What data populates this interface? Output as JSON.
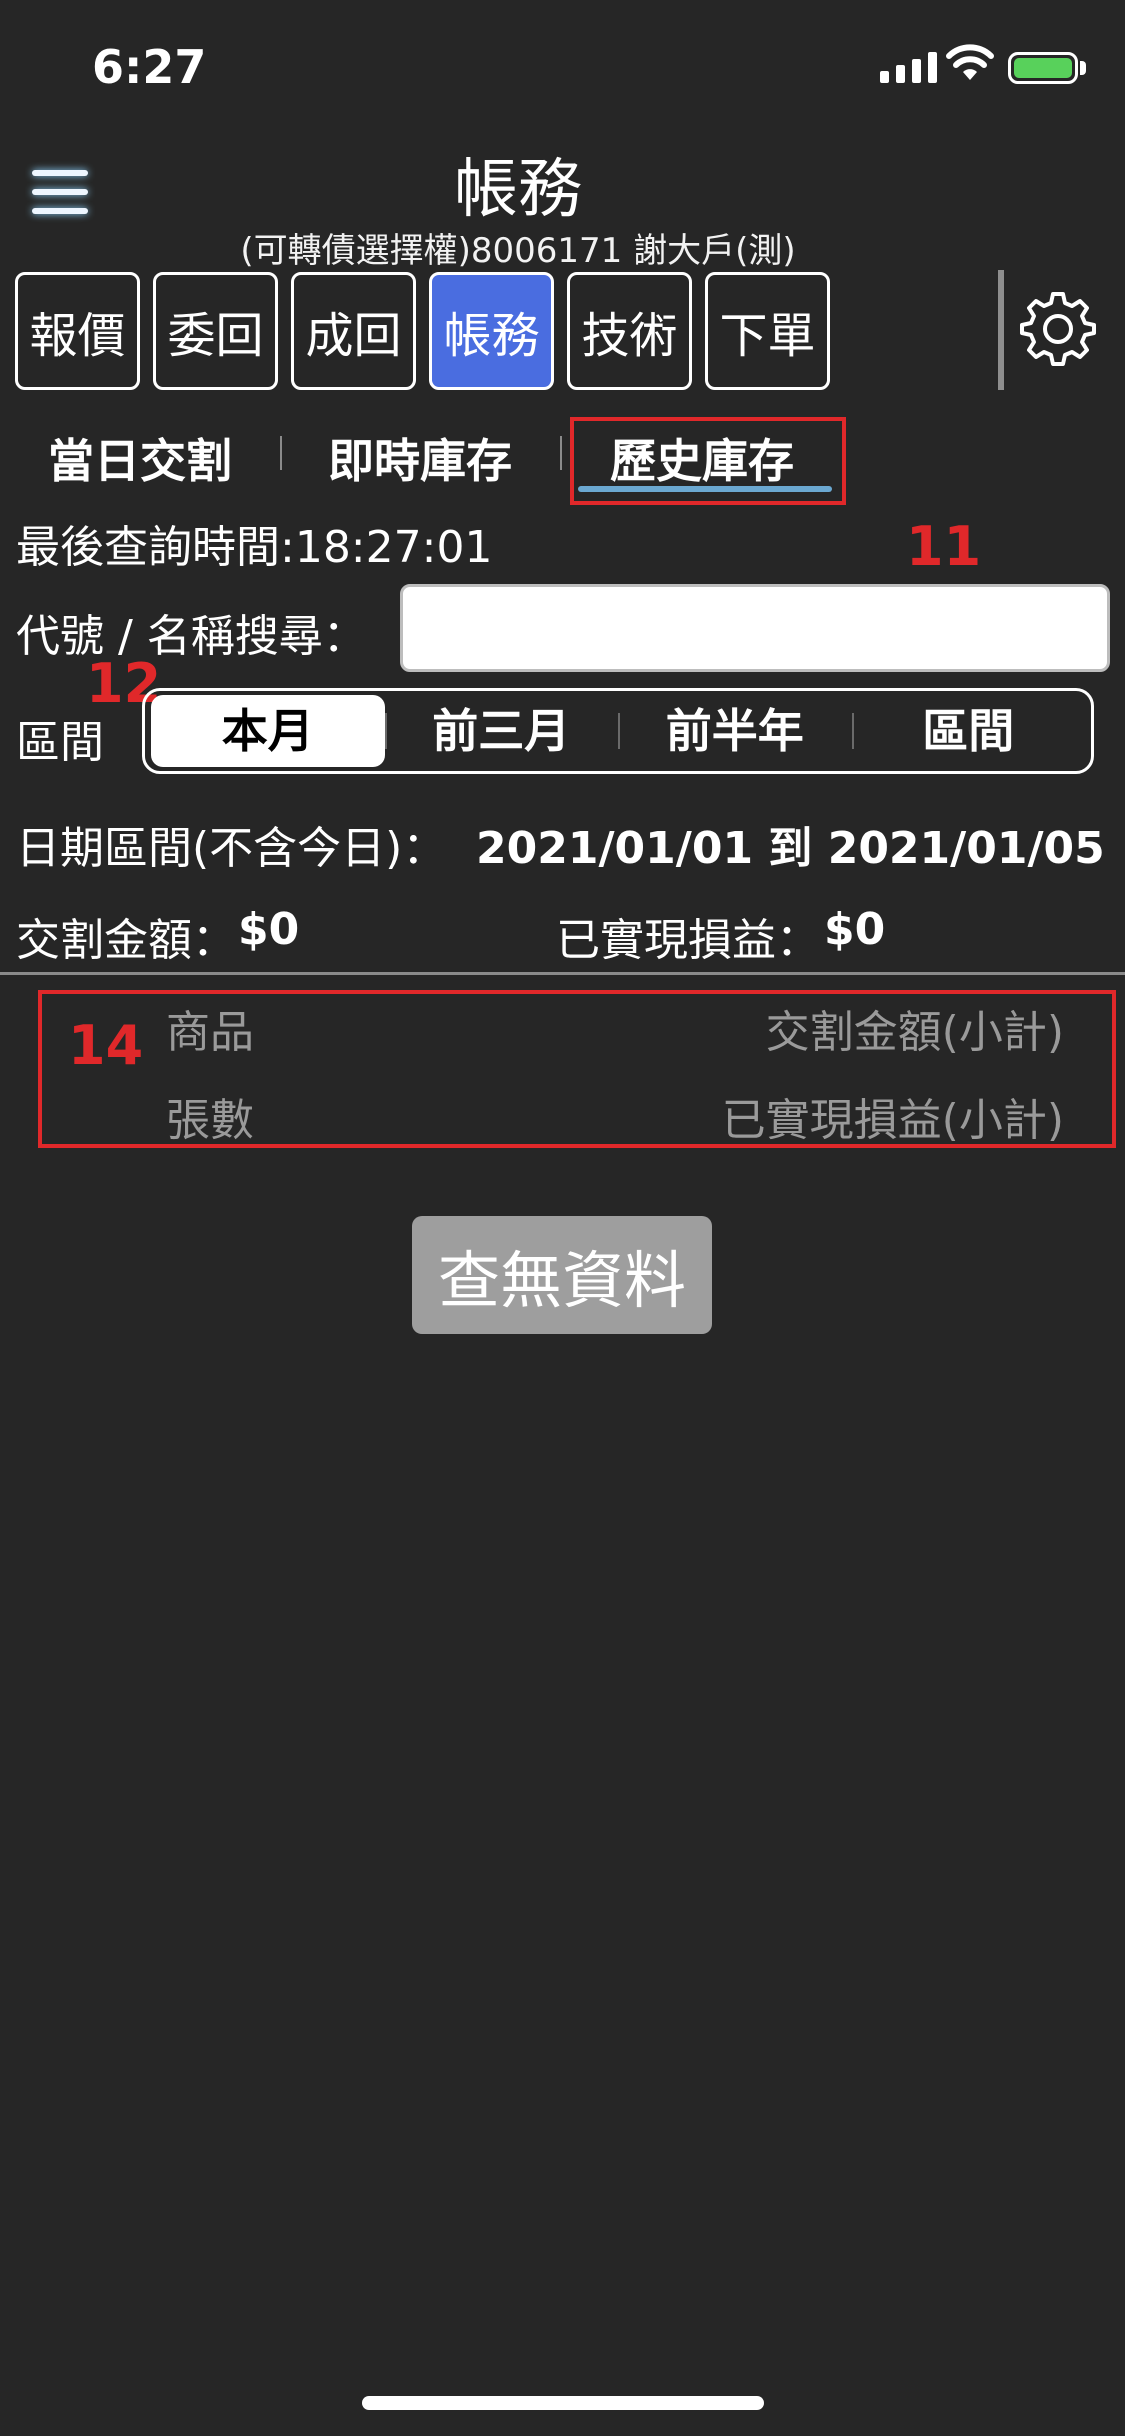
{
  "status_bar": {
    "time": "6:27",
    "battery_color": "#58d15b"
  },
  "header": {
    "title": "帳務",
    "subtitle": "(可轉債選擇權)8006171 謝大戶(測)"
  },
  "tabs": [
    {
      "label": "報價"
    },
    {
      "label": "委回"
    },
    {
      "label": "成回"
    },
    {
      "label": "帳務",
      "active": true
    },
    {
      "label": "技術"
    },
    {
      "label": "下單"
    }
  ],
  "subtabs": [
    {
      "label": "當日交割"
    },
    {
      "label": "即時庫存"
    },
    {
      "label": "歷史庫存",
      "active": true
    }
  ],
  "annotations": {
    "a11": "11",
    "a12": "12",
    "a14": "14"
  },
  "query": {
    "last_time_label": "最後查詢時間:18:27:01"
  },
  "search": {
    "label": "代號 / 名稱搜尋：",
    "value": ""
  },
  "period": {
    "label": "區間",
    "options": [
      "本月",
      "前三月",
      "前半年",
      "區間"
    ],
    "selected": "本月"
  },
  "date_range": {
    "label": "日期區間(不含今日)：",
    "value": "2021/01/01 到 2021/01/05"
  },
  "summary": {
    "settlement_label": "交割金額：",
    "settlement_value": "$0",
    "pnl_label": "已實現損益：",
    "pnl_value": "$0"
  },
  "table_header": {
    "product": "商品",
    "settlement_subtotal": "交割金額(小計)",
    "lots": "張數",
    "pnl_subtotal": "已實現損益(小計)"
  },
  "empty_message": "查無資料",
  "colors": {
    "accent": "#4a6de0",
    "annotation": "#e0282a",
    "background": "#262626"
  }
}
